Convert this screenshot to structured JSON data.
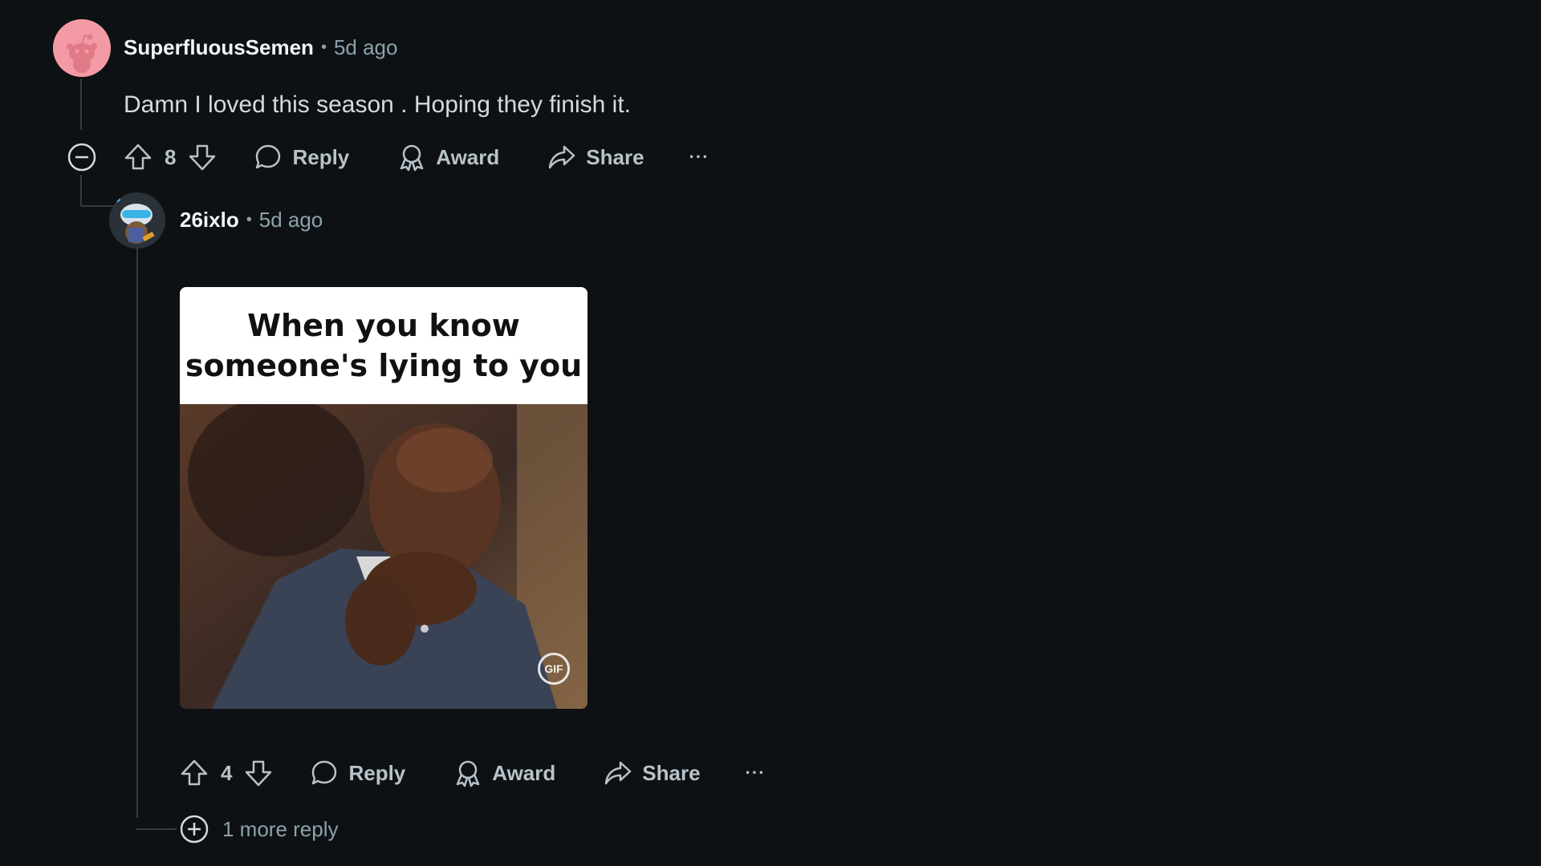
{
  "colors": {
    "background": "#0e1113",
    "text_primary": "#f2f4f5",
    "text_secondary": "#8ba2ad",
    "action_text": "#b7c2c9",
    "thread_line": "#33393d",
    "avatar1_bg": "#f49aa5"
  },
  "comment1": {
    "author": "SuperfluousSemen",
    "separator": "•",
    "time": "5d ago",
    "body": "Damn I loved this season . Hoping they finish it.",
    "avatar_icon": "snoo-avatar-icon",
    "actions": {
      "votes": "8",
      "reply": "Reply",
      "award": "Award",
      "share": "Share",
      "more": "···"
    }
  },
  "comment2": {
    "author": "26ixlo",
    "separator": "•",
    "time": "5d ago",
    "gif": {
      "caption": "When you know\nsomeone's lying to you",
      "badge": "GIF"
    },
    "avatar_icon": "snoo-avatar-icon",
    "actions": {
      "votes": "4",
      "reply": "Reply",
      "award": "Award",
      "share": "Share",
      "more": "···"
    },
    "more_replies": "1 more reply"
  }
}
